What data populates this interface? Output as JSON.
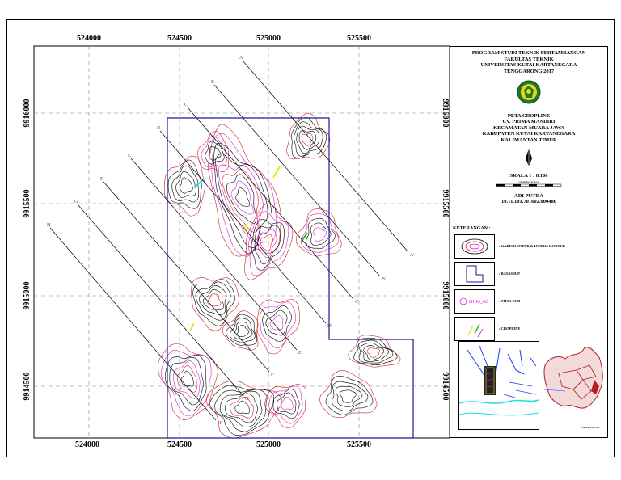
{
  "map": {
    "x_ticks": [
      "524000",
      "524500",
      "525000",
      "525500"
    ],
    "y_ticks_left": [
      "9916000",
      "9915500",
      "9915000",
      "9914500"
    ],
    "y_ticks_right": [
      "9916000",
      "9915500",
      "9915000",
      "9914500"
    ],
    "profile_start_labels": [
      "A",
      "B",
      "C",
      "D",
      "E",
      "F",
      "G",
      "H"
    ],
    "profile_end_labels": [
      "A'",
      "B'",
      "C'",
      "D'",
      "E'",
      "F'",
      "G'",
      "H'"
    ],
    "colors": {
      "contour_major": "#000000",
      "contour_minor": "#cc2222",
      "contour_magenta": "#dd22dd",
      "boundary": "#1a1a99",
      "grid": "#888888",
      "cropline_yellow": "#e8e820",
      "cropline_green": "#22bb22",
      "cropline_cyan": "#22dddd"
    }
  },
  "title_block": {
    "line1": "PROGRAM STUDI TEKNIK PERTAMBANGAN",
    "line2": "FAKULTAS TEKNIK",
    "line3": "UNIVERSITAS KUTAI KARTANEGARA",
    "line4": "TENGGARONG 2017",
    "map_title_1": "PETA CROPLINE",
    "map_title_2": "CV. PRIMA MANDIRI",
    "map_title_3": "KECAMATAN MUARA JAWA",
    "map_title_4": "KABUPATEN KUTAI KARTANEGARA",
    "map_title_5": "KALIMANTAN TIMUR",
    "scale": "SKALA 1 : 8.100",
    "scalebar_label": "GRAPHIC SCALE",
    "author": "ADI PUTRA",
    "author_id": "10.11.101.701602.000480"
  },
  "legend": {
    "heading": "KETERANGAN :",
    "items": [
      {
        "label": ": GARIS KONTUR & INDEKS KONTUR"
      },
      {
        "label": ": BATAS IUP"
      },
      {
        "label": ": TITIK BOR",
        "sample_text": "DHM_02"
      },
      {
        "label": ": CROPLINE"
      }
    ]
  },
  "inset": {
    "caption": "INDEKS PETA"
  }
}
